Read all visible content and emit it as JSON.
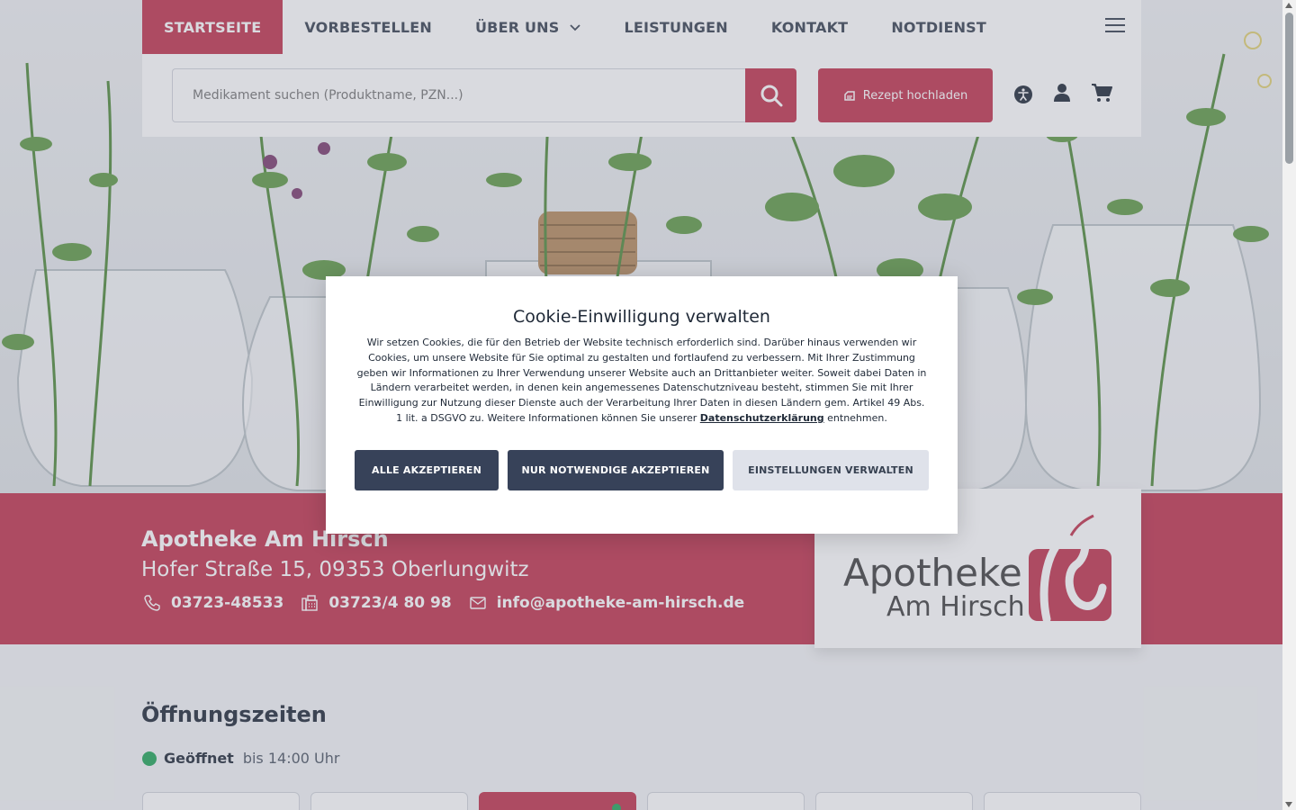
{
  "nav": {
    "items": [
      {
        "label": "STARTSEITE"
      },
      {
        "label": "VORBESTELLEN"
      },
      {
        "label": "ÜBER UNS"
      },
      {
        "label": "LEISTUNGEN"
      },
      {
        "label": "KONTAKT"
      },
      {
        "label": "NOTDIENST"
      }
    ]
  },
  "search": {
    "placeholder": "Medikament suchen (Produktname, PZN...)",
    "upload_label": "Rezept hochladen"
  },
  "icons": {
    "search": "search-icon",
    "upload": "prescription-upload-icon",
    "accessibility": "accessibility-icon",
    "account": "user-icon",
    "cart": "cart-icon",
    "menu": "hamburger-menu-icon",
    "phone": "phone-icon",
    "fax": "fax-icon",
    "email": "mail-icon"
  },
  "pharmacy": {
    "name": "Apotheke Am Hirsch",
    "address": "Hofer Straße 15, 09353 Oberlungwitz",
    "phone": "03723-48533",
    "fax": "03723/4 80 98",
    "email": "info@apotheke-am-hirsch.de",
    "logo_line1": "Apotheke",
    "logo_line2": "Am Hirsch"
  },
  "opening_hours": {
    "title": "Öffnungszeiten",
    "status": "Geöffnet",
    "until": "bis 14:00 Uhr"
  },
  "cookie": {
    "title": "Cookie-Einwilligung verwalten",
    "text_before": "Wir setzen Cookies, die für den Betrieb der Website technisch erforderlich sind. Darüber hinaus verwenden wir Cookies, um unsere Website für Sie optimal zu gestalten und fortlaufend zu verbessern. Mit Ihrer Zustimmung geben wir Informationen zu Ihrer Verwendung unserer Website auch an Drittanbieter weiter. Soweit dabei Daten in Ländern verarbeitet werden, in denen kein angemessenes Datenschutzniveau besteht, stimmen Sie mit Ihrer Einwilligung zur Nutzung dieser Dienste auch der Verarbeitung Ihrer Daten in diesen Ländern gem. Artikel 49 Abs. 1 lit. a DSGVO zu. Weitere Informationen können Sie unserer",
    "link_label": "Datenschutzerklärung",
    "text_after": "entnehmen.",
    "accept_all": "ALLE AKZEPTIEREN",
    "accept_necessary": "NUR NOTWENDIGE AKZEPTIEREN",
    "manage_settings": "EINSTELLUNGEN VERWALTEN"
  },
  "colors": {
    "brand_red": "#c0334d",
    "dark_button": "#374259",
    "light_button": "#dfe2ea",
    "open_green": "#22a559"
  }
}
